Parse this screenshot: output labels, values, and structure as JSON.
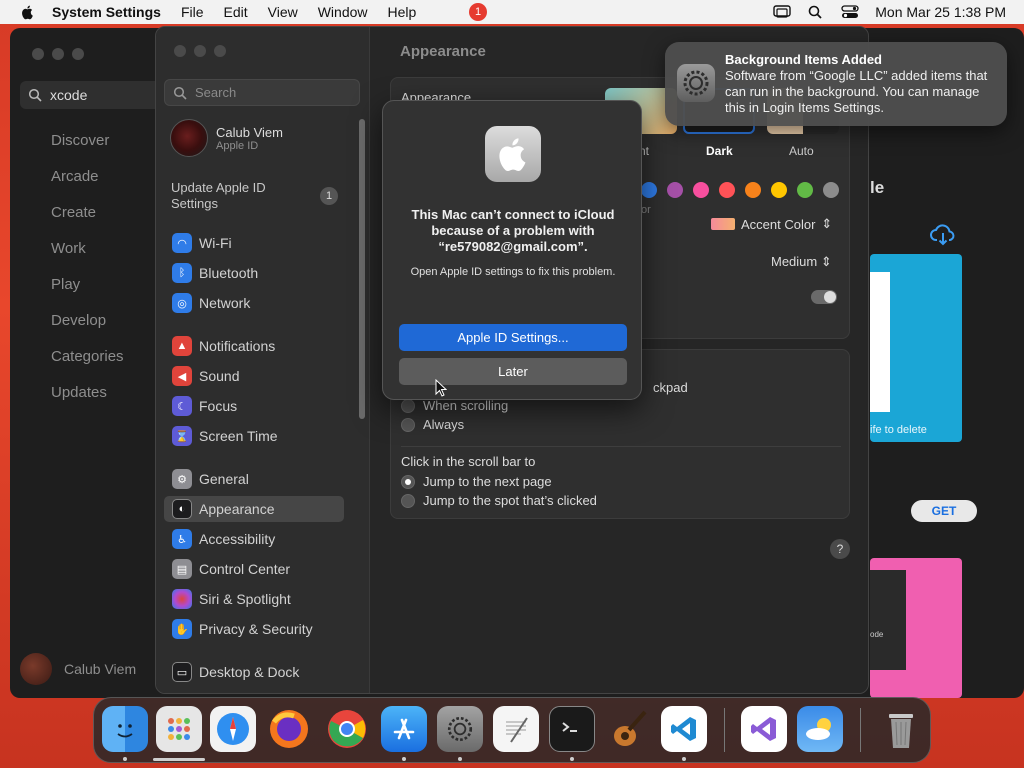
{
  "menubar": {
    "app_name": "System Settings",
    "items": [
      "File",
      "Edit",
      "View",
      "Window",
      "Help"
    ],
    "datetime": "Mon Mar 25  1:38 PM"
  },
  "appstore": {
    "search_value": "xcode",
    "nav": [
      "Discover",
      "Arcade",
      "Create",
      "Work",
      "Play",
      "Develop",
      "Categories",
      "Updates"
    ],
    "user_name": "Calub Viem",
    "heading_fragment": "le",
    "tile1_text": "ife to delete",
    "tile2_text": "ode",
    "get_label": "GET"
  },
  "settings": {
    "search_placeholder": "Search",
    "user_name": "Calub Viem",
    "user_sub": "Apple ID",
    "update_label": "Update Apple ID Settings",
    "update_badge": "1",
    "items": [
      {
        "label": "Wi-Fi",
        "color": "#2f7ce8"
      },
      {
        "label": "Bluetooth",
        "color": "#2f7ce8"
      },
      {
        "label": "Network",
        "color": "#2f7ce8"
      },
      {
        "label": "Notifications",
        "color": "#e0443b"
      },
      {
        "label": "Sound",
        "color": "#e0443b"
      },
      {
        "label": "Focus",
        "color": "#5e5bd6"
      },
      {
        "label": "Screen Time",
        "color": "#5e5bd6"
      },
      {
        "label": "General",
        "color": "#8e8e93"
      },
      {
        "label": "Appearance",
        "color": "#1c1c1e"
      },
      {
        "label": "Accessibility",
        "color": "#2f7ce8"
      },
      {
        "label": "Control Center",
        "color": "#8e8e93"
      },
      {
        "label": "Siri & Spotlight",
        "color": "#b04ad0"
      },
      {
        "label": "Privacy & Security",
        "color": "#2f7ce8"
      },
      {
        "label": "Desktop & Dock",
        "color": "#1c1c1e"
      }
    ],
    "content_title": "Appearance",
    "group_label": "Appearance",
    "thumb_labels": [
      "nt",
      "Dark",
      "Auto"
    ],
    "accent_fragment": "or",
    "accent_color_label": "Accent Color",
    "sidebar_size_value": "Medium",
    "scroll_fragment": "ckpad",
    "radio_when_scrolling": "When scrolling",
    "radio_always": "Always",
    "click_label": "Click in the scroll bar to",
    "radio_next_page": "Jump to the next page",
    "radio_spot": "Jump to the spot that’s clicked",
    "help": "?"
  },
  "alert": {
    "title": "This Mac can’t connect to iCloud because of a problem with “re579082@gmail.com”.",
    "message": "Open Apple ID settings to fix this problem.",
    "primary": "Apple ID Settings...",
    "secondary": "Later"
  },
  "notification": {
    "title": "Background Items Added",
    "body": "Software from “Google LLC” added items that can run in the background. You can manage this in Login Items Settings."
  },
  "dock": {
    "apps": [
      "Finder",
      "Launchpad",
      "Safari",
      "Firefox",
      "Chrome",
      "App Store",
      "System Settings",
      "TextEdit",
      "Terminal",
      "GarageBand",
      "Visual Studio Code",
      "Visual Studio",
      "Weather",
      "Trash"
    ],
    "badge": "1"
  }
}
